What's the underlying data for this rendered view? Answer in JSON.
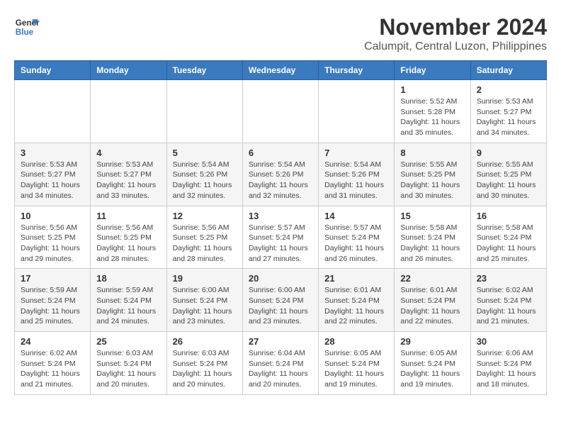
{
  "header": {
    "logo_line1": "General",
    "logo_line2": "Blue",
    "month_year": "November 2024",
    "location": "Calumpit, Central Luzon, Philippines"
  },
  "weekdays": [
    "Sunday",
    "Monday",
    "Tuesday",
    "Wednesday",
    "Thursday",
    "Friday",
    "Saturday"
  ],
  "weeks": [
    [
      {
        "day": "",
        "detail": ""
      },
      {
        "day": "",
        "detail": ""
      },
      {
        "day": "",
        "detail": ""
      },
      {
        "day": "",
        "detail": ""
      },
      {
        "day": "",
        "detail": ""
      },
      {
        "day": "1",
        "detail": "Sunrise: 5:52 AM\nSunset: 5:28 PM\nDaylight: 11 hours and 35 minutes."
      },
      {
        "day": "2",
        "detail": "Sunrise: 5:53 AM\nSunset: 5:27 PM\nDaylight: 11 hours and 34 minutes."
      }
    ],
    [
      {
        "day": "3",
        "detail": "Sunrise: 5:53 AM\nSunset: 5:27 PM\nDaylight: 11 hours and 34 minutes."
      },
      {
        "day": "4",
        "detail": "Sunrise: 5:53 AM\nSunset: 5:27 PM\nDaylight: 11 hours and 33 minutes."
      },
      {
        "day": "5",
        "detail": "Sunrise: 5:54 AM\nSunset: 5:26 PM\nDaylight: 11 hours and 32 minutes."
      },
      {
        "day": "6",
        "detail": "Sunrise: 5:54 AM\nSunset: 5:26 PM\nDaylight: 11 hours and 32 minutes."
      },
      {
        "day": "7",
        "detail": "Sunrise: 5:54 AM\nSunset: 5:26 PM\nDaylight: 11 hours and 31 minutes."
      },
      {
        "day": "8",
        "detail": "Sunrise: 5:55 AM\nSunset: 5:25 PM\nDaylight: 11 hours and 30 minutes."
      },
      {
        "day": "9",
        "detail": "Sunrise: 5:55 AM\nSunset: 5:25 PM\nDaylight: 11 hours and 30 minutes."
      }
    ],
    [
      {
        "day": "10",
        "detail": "Sunrise: 5:56 AM\nSunset: 5:25 PM\nDaylight: 11 hours and 29 minutes."
      },
      {
        "day": "11",
        "detail": "Sunrise: 5:56 AM\nSunset: 5:25 PM\nDaylight: 11 hours and 28 minutes."
      },
      {
        "day": "12",
        "detail": "Sunrise: 5:56 AM\nSunset: 5:25 PM\nDaylight: 11 hours and 28 minutes."
      },
      {
        "day": "13",
        "detail": "Sunrise: 5:57 AM\nSunset: 5:24 PM\nDaylight: 11 hours and 27 minutes."
      },
      {
        "day": "14",
        "detail": "Sunrise: 5:57 AM\nSunset: 5:24 PM\nDaylight: 11 hours and 26 minutes."
      },
      {
        "day": "15",
        "detail": "Sunrise: 5:58 AM\nSunset: 5:24 PM\nDaylight: 11 hours and 26 minutes."
      },
      {
        "day": "16",
        "detail": "Sunrise: 5:58 AM\nSunset: 5:24 PM\nDaylight: 11 hours and 25 minutes."
      }
    ],
    [
      {
        "day": "17",
        "detail": "Sunrise: 5:59 AM\nSunset: 5:24 PM\nDaylight: 11 hours and 25 minutes."
      },
      {
        "day": "18",
        "detail": "Sunrise: 5:59 AM\nSunset: 5:24 PM\nDaylight: 11 hours and 24 minutes."
      },
      {
        "day": "19",
        "detail": "Sunrise: 6:00 AM\nSunset: 5:24 PM\nDaylight: 11 hours and 23 minutes."
      },
      {
        "day": "20",
        "detail": "Sunrise: 6:00 AM\nSunset: 5:24 PM\nDaylight: 11 hours and 23 minutes."
      },
      {
        "day": "21",
        "detail": "Sunrise: 6:01 AM\nSunset: 5:24 PM\nDaylight: 11 hours and 22 minutes."
      },
      {
        "day": "22",
        "detail": "Sunrise: 6:01 AM\nSunset: 5:24 PM\nDaylight: 11 hours and 22 minutes."
      },
      {
        "day": "23",
        "detail": "Sunrise: 6:02 AM\nSunset: 5:24 PM\nDaylight: 11 hours and 21 minutes."
      }
    ],
    [
      {
        "day": "24",
        "detail": "Sunrise: 6:02 AM\nSunset: 5:24 PM\nDaylight: 11 hours and 21 minutes."
      },
      {
        "day": "25",
        "detail": "Sunrise: 6:03 AM\nSunset: 5:24 PM\nDaylight: 11 hours and 20 minutes."
      },
      {
        "day": "26",
        "detail": "Sunrise: 6:03 AM\nSunset: 5:24 PM\nDaylight: 11 hours and 20 minutes."
      },
      {
        "day": "27",
        "detail": "Sunrise: 6:04 AM\nSunset: 5:24 PM\nDaylight: 11 hours and 20 minutes."
      },
      {
        "day": "28",
        "detail": "Sunrise: 6:05 AM\nSunset: 5:24 PM\nDaylight: 11 hours and 19 minutes."
      },
      {
        "day": "29",
        "detail": "Sunrise: 6:05 AM\nSunset: 5:24 PM\nDaylight: 11 hours and 19 minutes."
      },
      {
        "day": "30",
        "detail": "Sunrise: 6:06 AM\nSunset: 5:24 PM\nDaylight: 11 hours and 18 minutes."
      }
    ]
  ]
}
